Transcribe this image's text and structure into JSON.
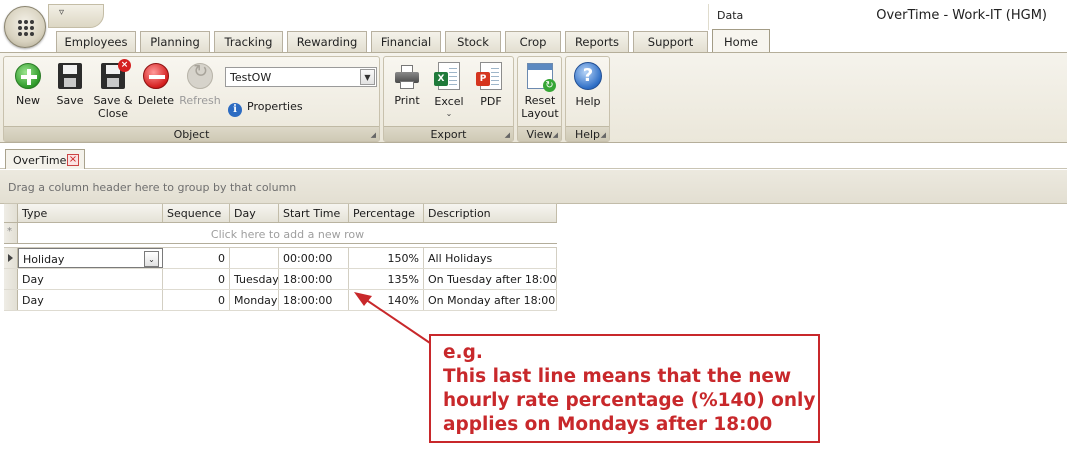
{
  "window": {
    "title": "OverTime - Work-IT (HGM)",
    "context_tab_group": "Data"
  },
  "ribbon_tabs": [
    {
      "label": "Employees"
    },
    {
      "label": "Planning"
    },
    {
      "label": "Tracking"
    },
    {
      "label": "Rewarding"
    },
    {
      "label": "Financial"
    },
    {
      "label": "Stock"
    },
    {
      "label": "Crop"
    },
    {
      "label": "Reports"
    },
    {
      "label": "Support"
    },
    {
      "label": "Home",
      "active": true
    }
  ],
  "ribbon": {
    "object_group": {
      "caption": "Object",
      "new": "New",
      "save": "Save",
      "save_close": "Save & Close",
      "delete": "Delete",
      "refresh": "Refresh",
      "selected_object": "TestOW",
      "properties": "Properties"
    },
    "export_group": {
      "caption": "Export",
      "print": "Print",
      "excel": "Excel",
      "pdf": "PDF"
    },
    "view_group": {
      "caption": "View",
      "reset_layout": "Reset Layout"
    },
    "help_group": {
      "caption": "Help",
      "help": "Help"
    }
  },
  "document_tab": {
    "label": "OverTime"
  },
  "grid": {
    "group_panel_hint": "Drag a column header here to group by that column",
    "new_row_hint": "Click here to add a new row",
    "columns": [
      "Type",
      "Sequence",
      "Day",
      "Start Time",
      "Percentage",
      "Description"
    ],
    "rows": [
      {
        "type": "Holiday",
        "sequence": "0",
        "day": "",
        "start_time": "00:00:00",
        "percentage": "150%",
        "description": "All Holidays",
        "current": true
      },
      {
        "type": "Day",
        "sequence": "0",
        "day": "Tuesday",
        "start_time": "18:00:00",
        "percentage": "135%",
        "description": "On Tuesday  after 18:00"
      },
      {
        "type": "Day",
        "sequence": "0",
        "day": "Monday",
        "start_time": "18:00:00",
        "percentage": "140%",
        "description": "On Monday after 18:00"
      }
    ]
  },
  "annotation": {
    "lines": [
      "e.g.",
      "This last line means that the new",
      "hourly rate percentage (%140) only",
      "applies on Mondays after 18:00"
    ],
    "color": "#c8282b"
  }
}
